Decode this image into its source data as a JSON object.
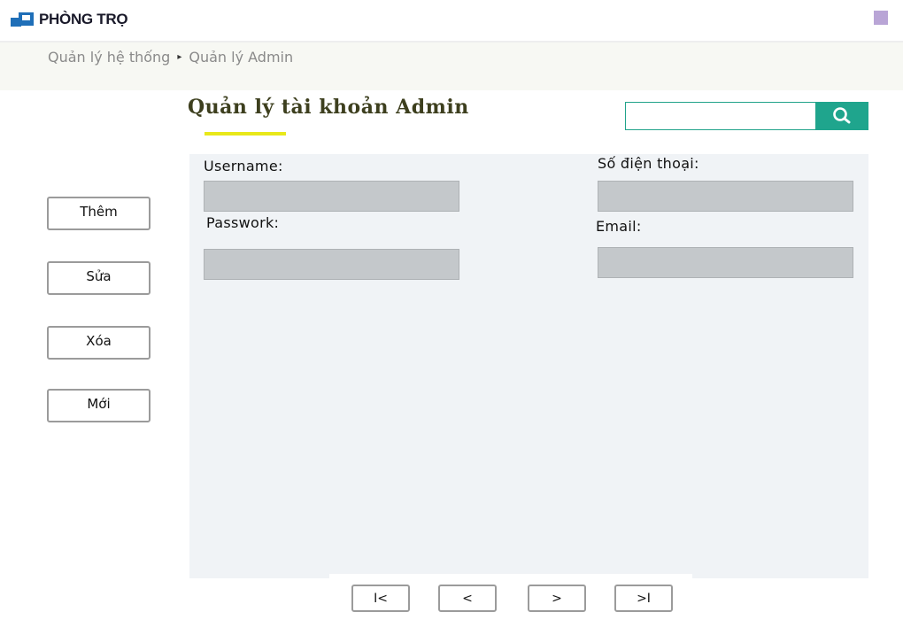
{
  "brand": {
    "name": "PHÒNG TRỌ",
    "icon": "logo-icon",
    "corner_color": "#b9a5d6"
  },
  "breadcrumb": {
    "items": [
      "Quản lý hệ thống",
      "Quản lý Admin"
    ],
    "separator": "▸"
  },
  "page": {
    "title": "Quản lý tài khoản Admin",
    "accent_color": "#e8e81a"
  },
  "search": {
    "value": "",
    "placeholder": "",
    "button_color": "#1fa58d",
    "icon": "search-icon"
  },
  "actions": {
    "add": "Thêm",
    "edit": "Sửa",
    "delete": "Xóa",
    "new": "Mới"
  },
  "form": {
    "username": {
      "label": "Username:",
      "value": ""
    },
    "password": {
      "label": "Passwork:",
      "value": ""
    },
    "phone": {
      "label": "Số điện thoại:",
      "value": ""
    },
    "email": {
      "label": "Email:",
      "value": ""
    }
  },
  "pager": {
    "first": "I<",
    "prev": "<",
    "next": ">",
    "last": ">I"
  }
}
